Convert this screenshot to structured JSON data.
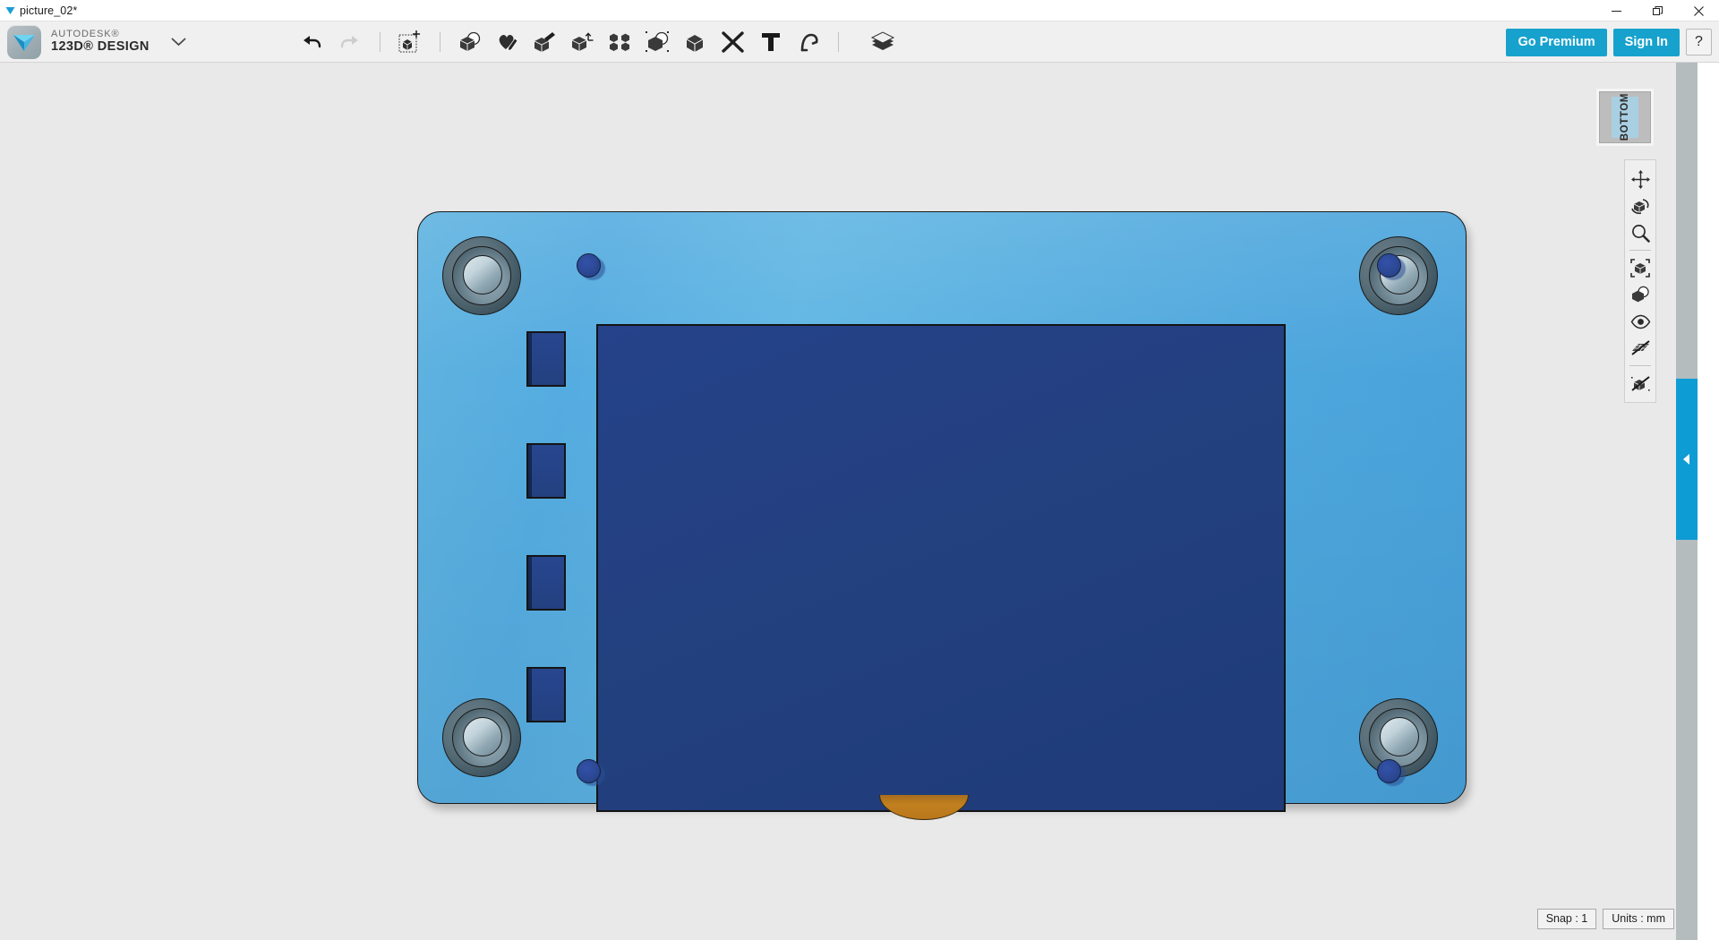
{
  "window": {
    "document_title": "picture_02*",
    "doc_chevron_icon": "chevron-down-icon",
    "controls": [
      {
        "name": "minimize",
        "icon": "minimize-icon",
        "glyph": "─"
      },
      {
        "name": "restore",
        "icon": "restore-icon",
        "glyph": "❐"
      },
      {
        "name": "close",
        "icon": "close-icon",
        "glyph": "✕"
      }
    ]
  },
  "brand": {
    "logo_icon": "autodesk-123d-logo-icon",
    "supertitle": "AUTODESK®",
    "title": "123D® DESIGN",
    "caret_icon": "chevron-down-icon"
  },
  "toolbar": {
    "items": [
      {
        "name": "undo",
        "icon": "undo-arrow-icon",
        "label": "Undo",
        "enabled": true
      },
      {
        "name": "redo",
        "icon": "redo-arrow-icon",
        "label": "Redo",
        "enabled": false
      },
      {
        "name": "transform",
        "icon": "transform-cube-icon",
        "label": "Transform",
        "enabled": true
      },
      {
        "name": "primitives",
        "icon": "primitives-cube-icon",
        "label": "Primitives",
        "enabled": true
      },
      {
        "name": "sketch",
        "icon": "sketch-pencil-icon",
        "label": "Sketch",
        "enabled": true
      },
      {
        "name": "construct",
        "icon": "construct-extrude-icon",
        "label": "Construct",
        "enabled": true
      },
      {
        "name": "modify",
        "icon": "modify-cube-icon",
        "label": "Modify",
        "enabled": true
      },
      {
        "name": "pattern",
        "icon": "pattern-grid-icon",
        "label": "Pattern",
        "enabled": true
      },
      {
        "name": "grouping",
        "icon": "grouping-cube-icon",
        "label": "Grouping",
        "enabled": true
      },
      {
        "name": "combine",
        "icon": "combine-cube-icon",
        "label": "Combine",
        "enabled": true
      },
      {
        "name": "measure",
        "icon": "measure-tools-icon",
        "label": "Measure",
        "enabled": true
      },
      {
        "name": "text",
        "icon": "text-t-icon",
        "label": "Text",
        "enabled": true
      },
      {
        "name": "snap",
        "icon": "snap-magnet-icon",
        "label": "Snap",
        "enabled": true
      },
      {
        "name": "material",
        "icon": "material-layers-icon",
        "label": "Material",
        "enabled": true
      }
    ]
  },
  "header_right": {
    "go_premium_label": "Go Premium",
    "sign_in_label": "Sign In",
    "help_label": "?",
    "accent_color": "#17a2cd"
  },
  "viewcube": {
    "face_label": "BOTTOM",
    "face_color": "#a9cfe2",
    "cube_color": "#bdbdbd"
  },
  "nav_toolbar": {
    "items": [
      {
        "name": "pan",
        "icon": "pan-arrows-icon",
        "label": "Pan"
      },
      {
        "name": "orbit",
        "icon": "orbit-cube-icon",
        "label": "Orbit"
      },
      {
        "name": "zoom",
        "icon": "zoom-magnifier-icon",
        "label": "Zoom"
      },
      {
        "name": "fit",
        "icon": "fit-to-view-icon",
        "label": "Fit"
      },
      {
        "name": "view-settings",
        "icon": "view-cube-overlap-icon",
        "label": "View Settings"
      },
      {
        "name": "visibility",
        "icon": "eye-icon",
        "label": "Visibility"
      },
      {
        "name": "grid-toggle",
        "icon": "grid-off-icon",
        "label": "Grid Off"
      },
      {
        "name": "snap-toggle",
        "icon": "snap-off-cube-icon",
        "label": "Snap Off"
      }
    ]
  },
  "panel_handle": {
    "icon": "collapse-left-arrow-icon",
    "color": "#0e9cd4"
  },
  "status_bar": {
    "snap": "Snap : 1",
    "units": "Units : mm"
  },
  "model": {
    "name": "raspberry-pi-style-board",
    "board_color": "#52acdf",
    "screen_color": "#23407f",
    "connector_color": "#b9761c",
    "edge_color": "#1a1a1a",
    "mounting_holes": 4,
    "pins": 4,
    "button_slots": 4
  }
}
